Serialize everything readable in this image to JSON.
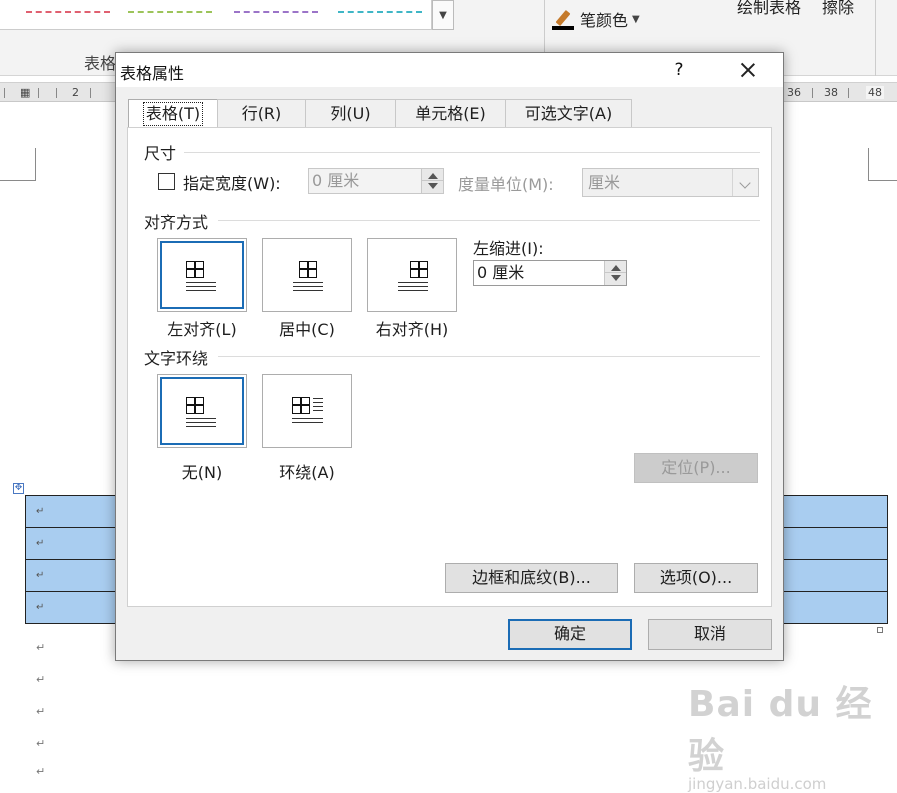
{
  "ribbon": {
    "group_label": "表格",
    "pen_color_label": "笔颜色",
    "draw_table_label": "绘制表格",
    "erase_label": "擦除",
    "swatch_colors": [
      "#e06070",
      "#9cc45a",
      "#9b74c8",
      "#3fb6c6"
    ]
  },
  "ruler": {
    "left_marks": [
      "2"
    ],
    "right_marks": [
      "36",
      "38",
      "48"
    ]
  },
  "watermark": {
    "logo": "Bai du 经验",
    "url": "jingyan.baidu.com"
  },
  "dialog": {
    "title": "表格属性",
    "help_label": "?",
    "tabs": [
      {
        "label": "表格(T)",
        "active": true
      },
      {
        "label": "行(R)",
        "active": false
      },
      {
        "label": "列(U)",
        "active": false
      },
      {
        "label": "单元格(E)",
        "active": false
      },
      {
        "label": "可选文字(A)",
        "active": false
      }
    ],
    "size": {
      "section_label": "尺寸",
      "preferred_width_label": "指定宽度(W):",
      "preferred_width_checked": false,
      "width_value": "0 厘米",
      "measure_in_label": "度量单位(M):",
      "measure_in_value": "厘米"
    },
    "alignment": {
      "section_label": "对齐方式",
      "options": [
        {
          "label": "左对齐(L)",
          "selected": true
        },
        {
          "label": "居中(C)",
          "selected": false
        },
        {
          "label": "右对齐(H)",
          "selected": false
        }
      ],
      "indent_label": "左缩进(I):",
      "indent_value": "0 厘米"
    },
    "wrapping": {
      "section_label": "文字环绕",
      "options": [
        {
          "label": "无(N)",
          "selected": true
        },
        {
          "label": "环绕(A)",
          "selected": false
        }
      ],
      "position_button": "定位(P)..."
    },
    "borders_button": "边框和底纹(B)...",
    "options_button": "选项(O)...",
    "ok_button": "确定",
    "cancel_button": "取消"
  },
  "document": {
    "table_rows": 4,
    "paragraph_mark": "↵"
  }
}
